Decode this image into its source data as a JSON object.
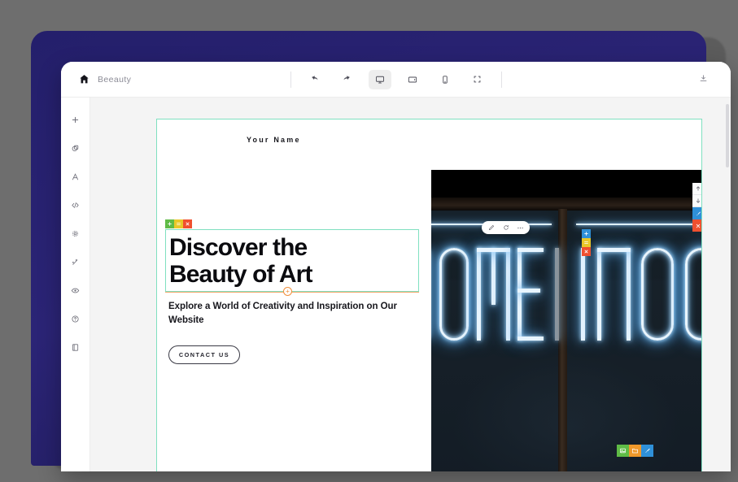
{
  "app": {
    "project_name": "Beeauty",
    "home_icon": "home-icon",
    "download_icon": "download-icon"
  },
  "toolbar": {
    "items": [
      {
        "name": "undo",
        "icon": "undo-icon",
        "active": false
      },
      {
        "name": "redo",
        "icon": "redo-icon",
        "active": false
      },
      {
        "name": "desktop-view",
        "icon": "desktop-icon",
        "active": true
      },
      {
        "name": "tablet-landscape-view",
        "icon": "tablet-landscape-icon",
        "active": false
      },
      {
        "name": "mobile-view",
        "icon": "mobile-icon",
        "active": false
      },
      {
        "name": "fullscreen",
        "icon": "fullscreen-icon",
        "active": false
      }
    ]
  },
  "sidebar": {
    "items": [
      {
        "name": "add-block",
        "icon": "plus-icon"
      },
      {
        "name": "blocks",
        "icon": "shapes-icon"
      },
      {
        "name": "typography",
        "icon": "text-icon"
      },
      {
        "name": "code",
        "icon": "code-icon"
      },
      {
        "name": "settings",
        "icon": "gear-icon"
      },
      {
        "name": "effects",
        "icon": "magic-wand-icon"
      },
      {
        "name": "preview",
        "icon": "eye-icon"
      },
      {
        "name": "help",
        "icon": "question-icon"
      },
      {
        "name": "pages",
        "icon": "pages-icon"
      }
    ]
  },
  "canvas": {
    "site_logo": "Your Name",
    "headline": "Discover the Beauty of Art",
    "headline_line1": "Discover the",
    "headline_line2": "Beauty of Art",
    "subheadline": "Explore a World of Creativity and Inspiration on Our Website",
    "cta_label": "CONTACT US",
    "hero_image_alt": "SOMETHING G",
    "hero_image_text": "SOMETHING G"
  },
  "overlays": {
    "section_badges": [
      {
        "name": "add-section",
        "icon": "plus-icon",
        "label": "+",
        "color": "#5fbb46"
      },
      {
        "name": "move-section",
        "icon": "drag-icon",
        "label": "≡",
        "color": "#e9c828"
      },
      {
        "name": "delete-section",
        "icon": "close-icon",
        "label": "×",
        "color": "#f0502f"
      }
    ],
    "block_badges": [
      {
        "name": "add-block",
        "icon": "plus-icon",
        "label": "+",
        "color": "#2f90d8"
      },
      {
        "name": "move-block",
        "icon": "drag-icon",
        "label": "≡",
        "color": "#e9c828"
      },
      {
        "name": "delete-block",
        "icon": "close-icon",
        "label": "×",
        "color": "#f0502f"
      }
    ],
    "float_tools": [
      {
        "name": "edit-element",
        "icon": "pencil-icon"
      },
      {
        "name": "refresh-element",
        "icon": "refresh-icon"
      },
      {
        "name": "more-options",
        "icon": "ellipsis-icon"
      }
    ],
    "right_dock": [
      {
        "name": "move-up",
        "icon": "arrow-up-icon",
        "label": "↑",
        "color": "#fbfbfb"
      },
      {
        "name": "move-down",
        "icon": "arrow-down-icon",
        "label": "↓",
        "color": "#fbfbfb"
      },
      {
        "name": "style-block",
        "icon": "brush-icon",
        "label": "",
        "color": "#2f90d8"
      },
      {
        "name": "delete-image-block",
        "icon": "close-icon",
        "label": "×",
        "color": "#f0502f"
      }
    ],
    "bottom_badges": [
      {
        "name": "change-image",
        "icon": "image-icon",
        "color": "#5fbb46"
      },
      {
        "name": "open-media-library",
        "icon": "folder-icon",
        "color": "#f0992b"
      },
      {
        "name": "style-image",
        "icon": "brush-icon",
        "color": "#2f90d8"
      }
    ]
  },
  "colors": {
    "brand_navy": "#241f6b",
    "page_background": "#6e6e6e",
    "selection_green": "#7fe0c0",
    "accent_orange": "#f08f3a",
    "accent_blue": "#2f90d8",
    "accent_red": "#f0502f"
  }
}
